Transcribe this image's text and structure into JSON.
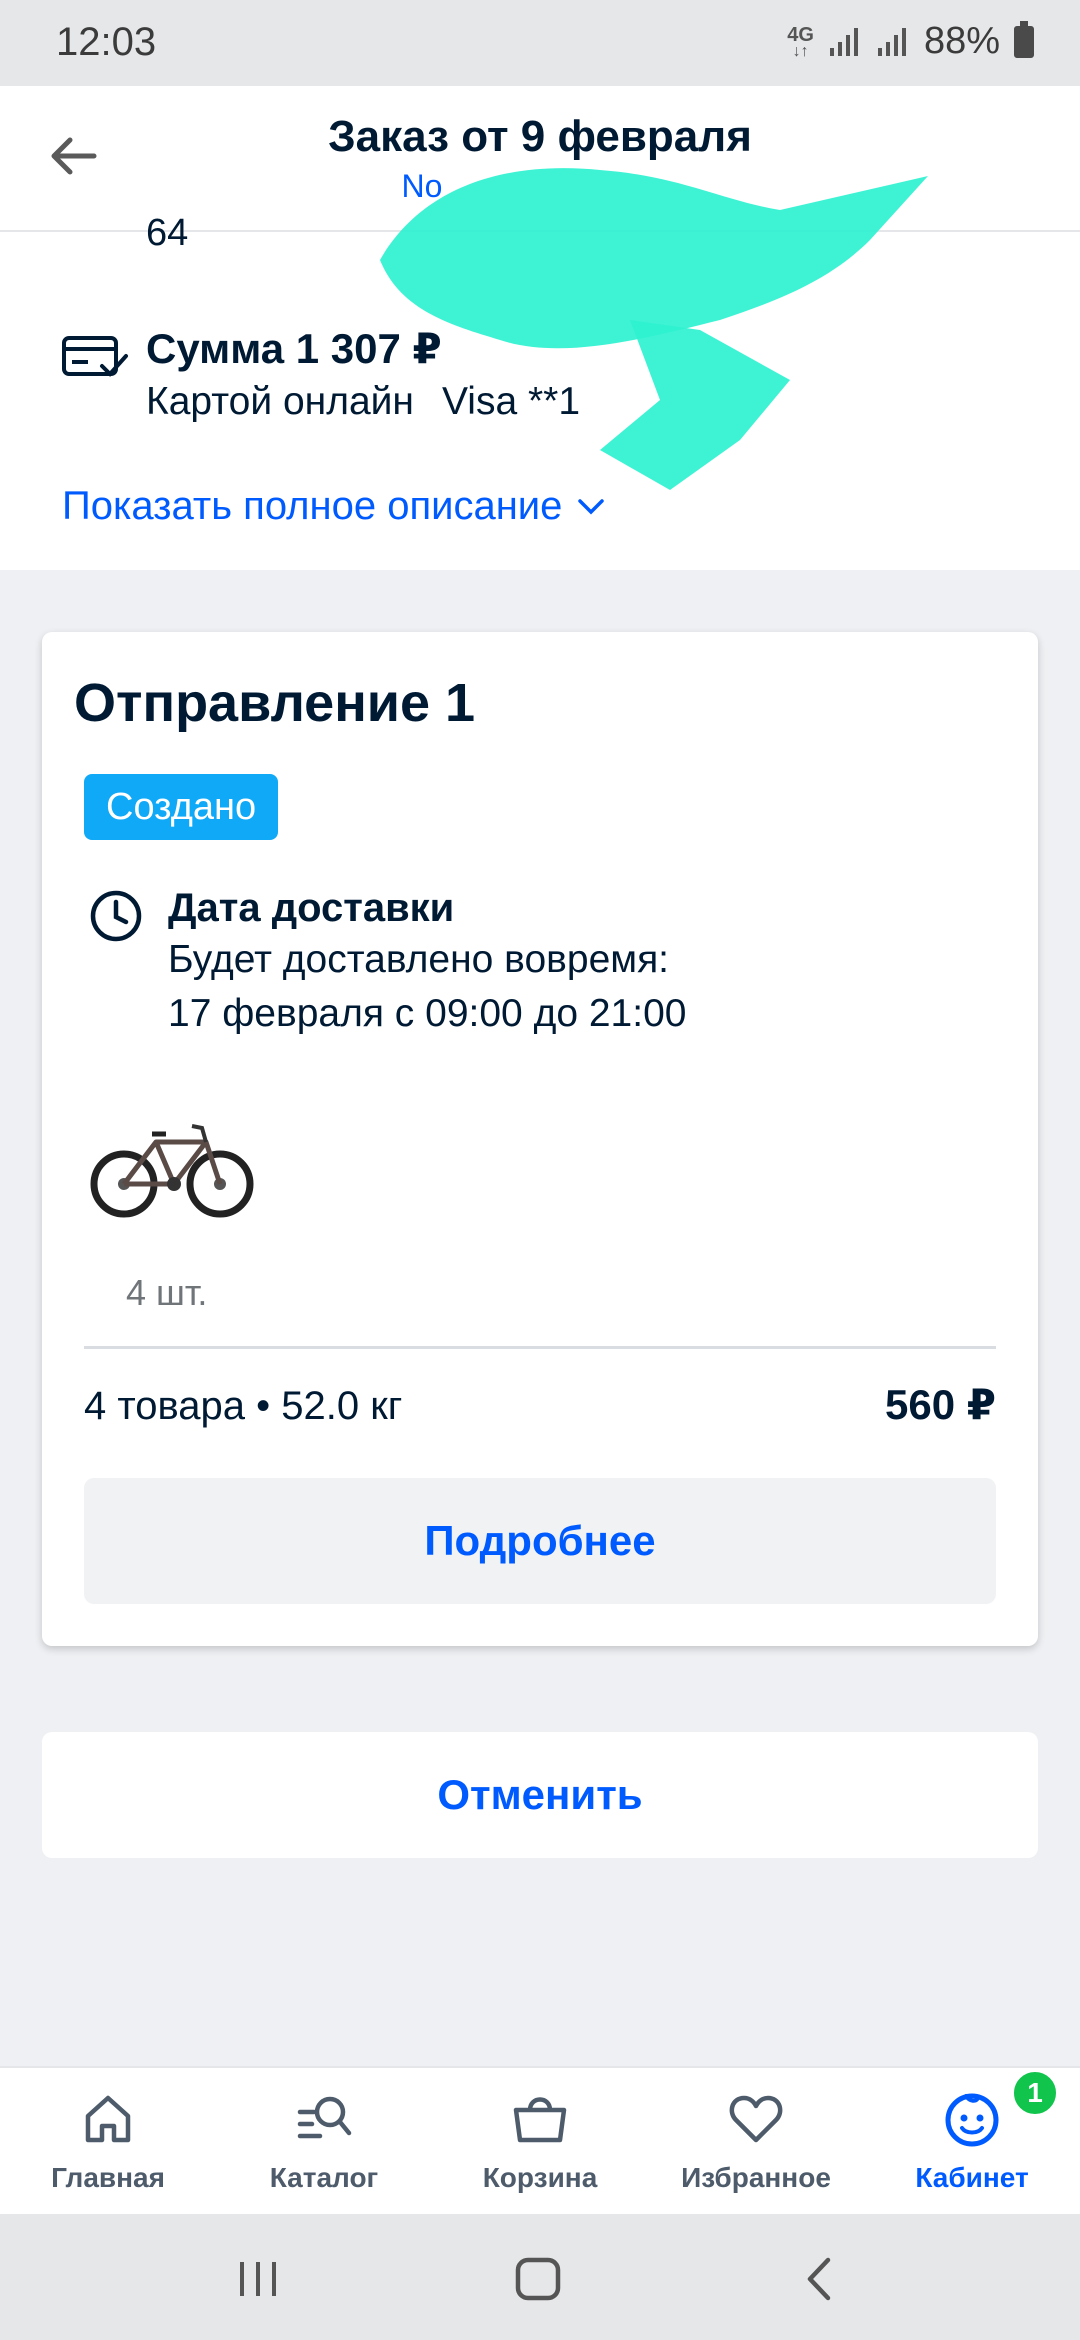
{
  "status_bar": {
    "time": "12:03",
    "network": "4G",
    "battery": "88%"
  },
  "header": {
    "title": "Заказ от 9 февраля",
    "subtitle": "No"
  },
  "summary": {
    "clipped_text": "64",
    "sum_label": "Сумма 1 307 ₽",
    "payment_method": "Картой онлайн",
    "card": "Visa **1",
    "show_more": "Показать полное описание"
  },
  "shipment": {
    "title": "Отправление 1",
    "status": "Создано",
    "delivery_title": "Дата доставки",
    "delivery_line1": "Будет доставлено вовремя:",
    "delivery_line2": "17 февраля с 09:00 до 21:00",
    "quantity": "4 шт.",
    "totals": "4 товара • 52.0 кг",
    "price": "560 ₽",
    "details_button": "Подробнее"
  },
  "cancel_button": "Отменить",
  "bottom_nav": {
    "items": [
      {
        "label": "Главная",
        "icon": "home-icon"
      },
      {
        "label": "Каталог",
        "icon": "catalog-search-icon"
      },
      {
        "label": "Корзина",
        "icon": "basket-icon"
      },
      {
        "label": "Избранное",
        "icon": "heart-icon"
      },
      {
        "label": "Кабинет",
        "icon": "profile-face-icon",
        "active": true,
        "badge": "1"
      }
    ]
  },
  "colors": {
    "accent": "#005bff",
    "badge_blue": "#10a9f7",
    "badge_green": "#10c44c",
    "text": "#001a34",
    "redaction": "#2ef2d0"
  }
}
